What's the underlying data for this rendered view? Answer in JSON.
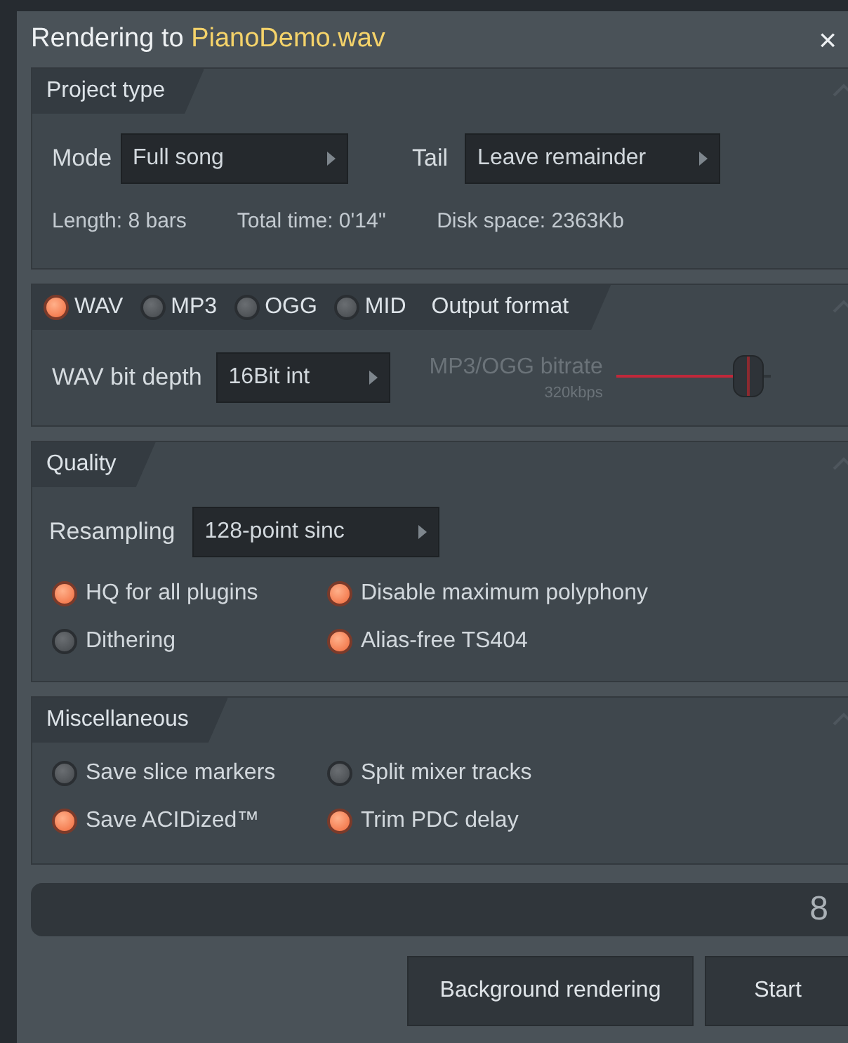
{
  "window": {
    "title": "Rendering to",
    "filename": "PianoDemo.wav",
    "close": "×"
  },
  "project_type": {
    "title": "Project type",
    "mode_label": "Mode",
    "mode_value": "Full song",
    "tail_label": "Tail",
    "tail_value": "Leave remainder",
    "stats": [
      "Length: 8 bars",
      "Total time: 0'14''",
      "Disk space: 2363Kb"
    ]
  },
  "output_format": {
    "title": "Output format",
    "formats": [
      {
        "label": "WAV",
        "selected": true
      },
      {
        "label": "MP3",
        "selected": false
      },
      {
        "label": "OGG",
        "selected": false
      },
      {
        "label": "MID",
        "selected": false
      }
    ],
    "bit_depth_label": "WAV bit depth",
    "bit_depth_value": "16Bit int",
    "bitrate_label": "MP3/OGG bitrate",
    "bitrate_value": "320kbps",
    "bitrate": {
      "level": 0.85
    }
  },
  "quality": {
    "title": "Quality",
    "resampling_label": "Resampling",
    "resampling_value": "128-point sinc",
    "options": [
      {
        "label": "HQ for all plugins",
        "checked": true
      },
      {
        "label": "Disable maximum polyphony",
        "checked": true
      },
      {
        "label": "Dithering",
        "checked": false
      },
      {
        "label": "Alias-free TS404",
        "checked": true
      }
    ]
  },
  "miscellaneous": {
    "title": "Miscellaneous",
    "options": [
      {
        "label": "Save slice markers",
        "checked": false
      },
      {
        "label": "Split mixer tracks",
        "checked": false
      },
      {
        "label": "Save ACIDized™",
        "checked": true
      },
      {
        "label": "Trim PDC delay",
        "checked": true
      }
    ]
  },
  "progress": {
    "value": "8",
    "level": 0
  },
  "buttons": [
    "Background rendering",
    "Start"
  ]
}
